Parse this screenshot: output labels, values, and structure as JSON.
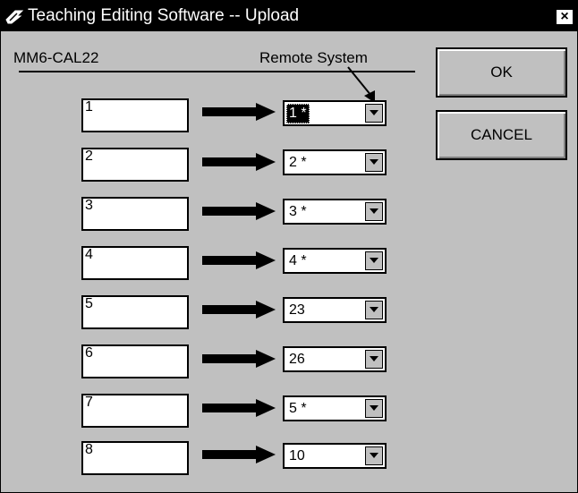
{
  "window": {
    "title": "Teaching Editing Software -- Upload",
    "close_glyph": "×",
    "icon": "teaching-pendant-icon"
  },
  "header": {
    "left_label": "MM6-CAL22",
    "right_label": "Remote System"
  },
  "rows": [
    {
      "slot": "1",
      "remote": "1 *"
    },
    {
      "slot": "2",
      "remote": "2 *"
    },
    {
      "slot": "3",
      "remote": "3 *"
    },
    {
      "slot": "4",
      "remote": "4 *"
    },
    {
      "slot": "5",
      "remote": "23"
    },
    {
      "slot": "6",
      "remote": "26"
    },
    {
      "slot": "7",
      "remote": "5 *"
    },
    {
      "slot": "8",
      "remote": "10"
    }
  ],
  "buttons": {
    "ok": "OK",
    "cancel": "CANCEL"
  }
}
